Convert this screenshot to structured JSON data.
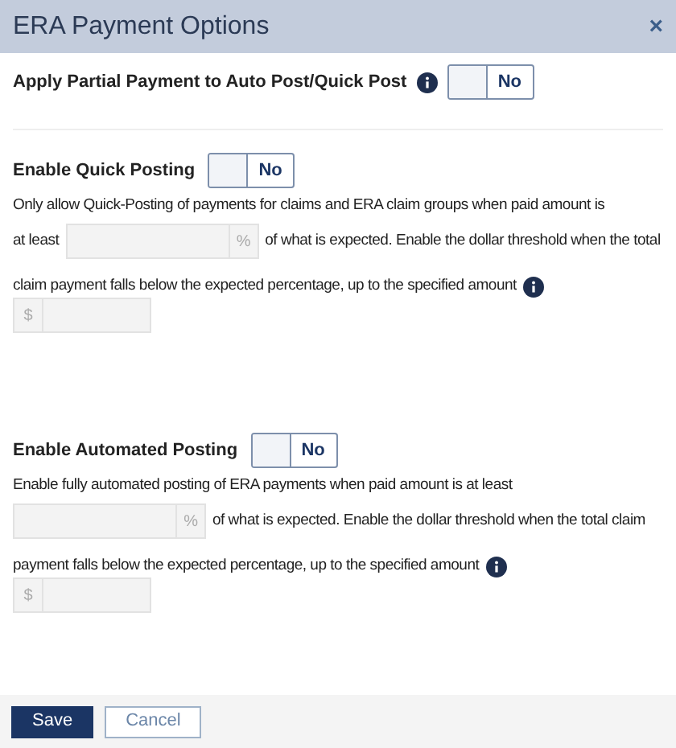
{
  "dialog": {
    "title": "ERA Payment Options",
    "close": "×"
  },
  "partial_payment": {
    "label": "Apply Partial Payment to Auto Post/Quick Post",
    "toggle": {
      "on": false,
      "label": "No"
    }
  },
  "sections": [
    {
      "label": "Enable Quick Posting",
      "toggle": {
        "on": false,
        "label": "No"
      },
      "line_1": "Only allow Quick-Posting of payments for claims and ERA claim groups when paid amount is",
      "line_2_before": "at least",
      "percent_field": {
        "suffix": "%",
        "disabled": true
      },
      "line_2_after": "of what is expected. Enable the dollar threshold when the total",
      "line_3": "claim payment falls below the expected percentage, up to the specified amount",
      "dollar_field": {
        "prefix": "$",
        "disabled": true
      }
    },
    {
      "label": "Enable Automated Posting",
      "toggle": {
        "on": false,
        "label": "No"
      },
      "line_1": "Enable fully automated posting of ERA payments when paid amount is at least",
      "percent_field": {
        "suffix": "%",
        "disabled": true
      },
      "line_2_after": "of what is expected. Enable the dollar threshold when the total claim",
      "line_3": "payment falls below the expected percentage, up to the specified amount",
      "dollar_field": {
        "prefix": "$",
        "disabled": true
      }
    }
  ],
  "footer": {
    "buttons": [
      {
        "label": "Save",
        "kind": "primary"
      },
      {
        "label": "Cancel",
        "kind": "secondary"
      }
    ]
  }
}
